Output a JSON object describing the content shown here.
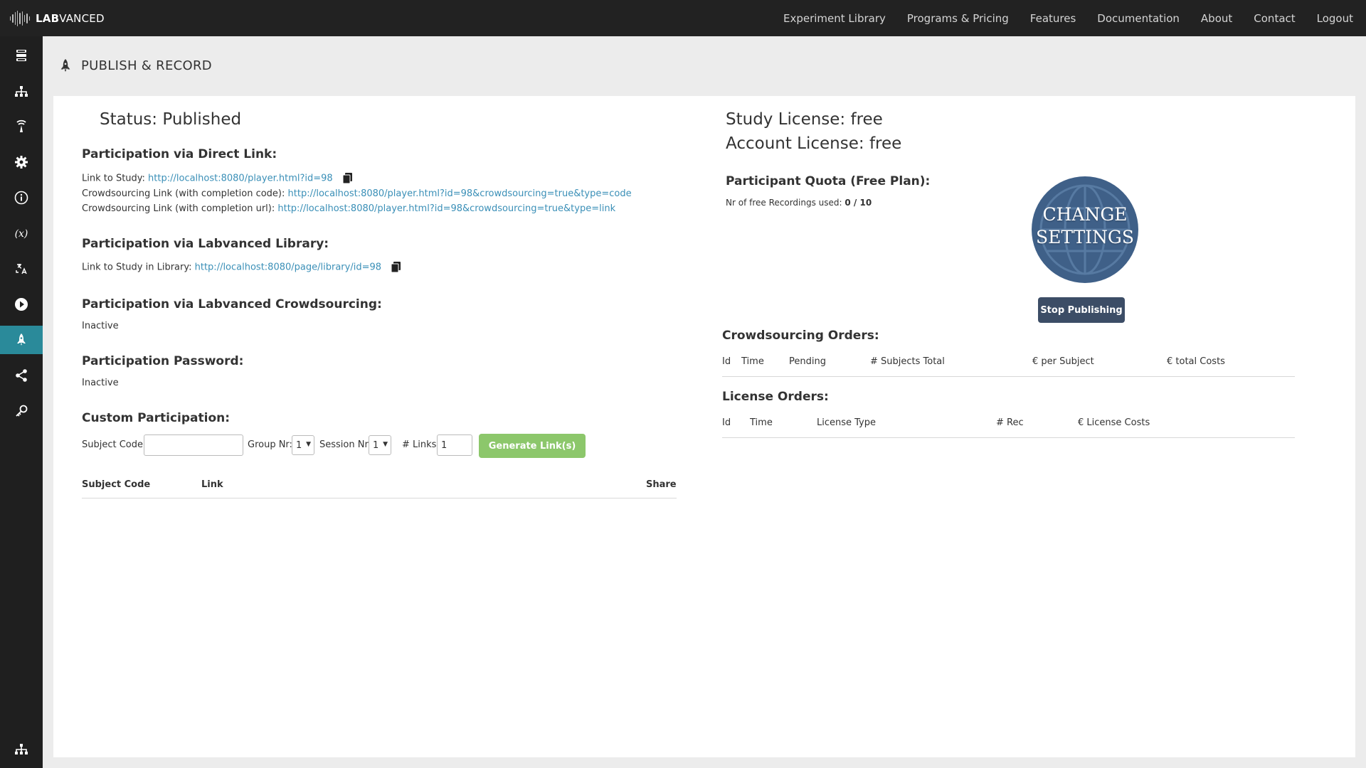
{
  "app": {
    "logo_bold": "LAB",
    "logo_light": "VANCED"
  },
  "nav": {
    "items": [
      "Experiment Library",
      "Programs & Pricing",
      "Features",
      "Documentation",
      "About",
      "Contact",
      "Logout"
    ]
  },
  "sidebar": {
    "items": [
      {
        "icon": "study-layout-icon"
      },
      {
        "icon": "task-tree-icon"
      },
      {
        "icon": "experiment-icon"
      },
      {
        "icon": "settings-gear-icon"
      },
      {
        "icon": "info-icon"
      },
      {
        "icon": "variables-icon"
      },
      {
        "icon": "translate-icon"
      },
      {
        "icon": "play-icon"
      },
      {
        "icon": "rocket-icon",
        "active": true
      },
      {
        "icon": "share-icon"
      },
      {
        "icon": "key-icon"
      }
    ],
    "footer_icon": "sitemap-icon",
    "active_color": "#2a8a9a"
  },
  "page": {
    "title": "PUBLISH & RECORD"
  },
  "left": {
    "status": "Status: Published",
    "direct": {
      "heading": "Participation via Direct Link:",
      "study_label": "Link to Study:",
      "study_url": "http://localhost:8080/player.html?id=98",
      "crowd_code_label": "Crowdsourcing Link (with completion code):",
      "crowd_code_url": "http://localhost:8080/player.html?id=98&crowdsourcing=true&type=code",
      "crowd_url_label": "Crowdsourcing Link (with completion url):",
      "crowd_url_url": "http://localhost:8080/player.html?id=98&crowdsourcing=true&type=link"
    },
    "library": {
      "heading": "Participation via Labvanced Library:",
      "label": "Link to Study in Library:",
      "url": "http://localhost:8080/page/library/id=98"
    },
    "crowdsourcing": {
      "heading": "Participation via Labvanced Crowdsourcing:",
      "value": "Inactive"
    },
    "password": {
      "heading": "Participation Password:",
      "value": "Inactive"
    },
    "custom": {
      "heading": "Custom Participation:",
      "subject_label": "Subject Code:",
      "subject_value": "",
      "group_label": "Group Nr:",
      "group_value": "1",
      "session_label": "Session Nr:",
      "session_value": "1",
      "links_label": "# Links:",
      "links_value": "1",
      "generate_label": "Generate Link(s)",
      "columns": [
        "Subject Code",
        "Link",
        "Share"
      ]
    }
  },
  "right": {
    "study_license": "Study License: free",
    "account_license": "Account License: free",
    "quota": {
      "heading": "Participant Quota (Free Plan):",
      "label": "Nr of free Recordings used:",
      "value": "0 / 10"
    },
    "badge": {
      "line1": "CHANGE",
      "line2": "SETTINGS"
    },
    "stop_label": "Stop Publishing",
    "crowd_orders": {
      "heading": "Crowdsourcing Orders:",
      "columns": [
        "Id",
        "Time",
        "Pending",
        "# Subjects Total",
        "€ per Subject",
        "€ total Costs"
      ]
    },
    "license_orders": {
      "heading": "License Orders:",
      "columns": [
        "Id",
        "Time",
        "License Type",
        "# Rec",
        "€ License Costs"
      ]
    }
  },
  "colors": {
    "topbar": "#222222",
    "sidebar": "#1f1f1f",
    "link": "#3a8fb7",
    "generate_button": "#8cc76b",
    "stop_button": "#3c4d66",
    "badge": "#3f6088"
  }
}
